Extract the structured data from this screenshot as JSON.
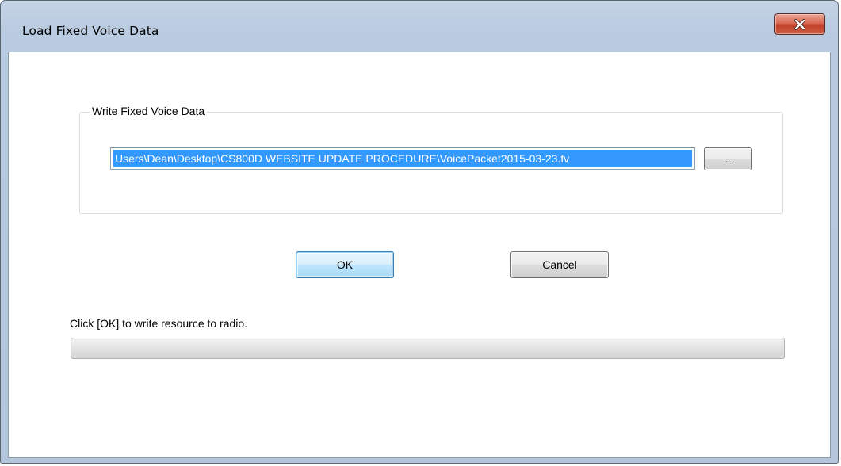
{
  "window": {
    "title": "Load Fixed Voice Data",
    "close_icon": "close-icon"
  },
  "group": {
    "label": "Write Fixed Voice Data",
    "path_value": "Users\\Dean\\Desktop\\CS800D WEBSITE UPDATE PROCEDURE\\VoicePacket2015-03-23.fv",
    "browse_label": "...."
  },
  "buttons": {
    "ok_label": "OK",
    "cancel_label": "Cancel"
  },
  "status": {
    "message": "Click [OK] to write resource to radio.",
    "progress": 0
  },
  "colors": {
    "selection": "#3399ff",
    "close_button": "#c7412b",
    "default_button_border": "#3c7fb1"
  }
}
